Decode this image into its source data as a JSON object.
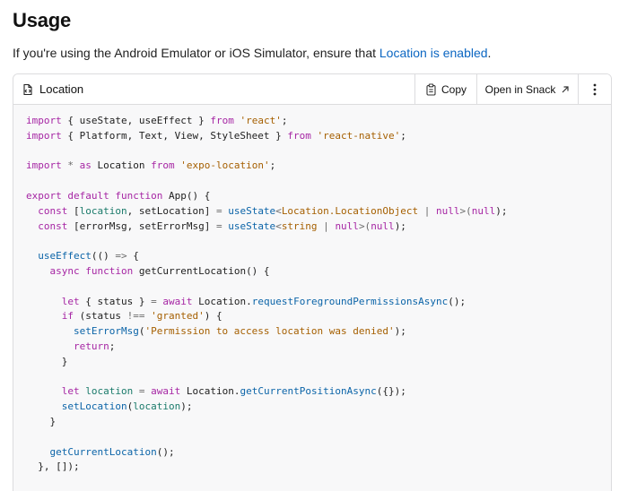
{
  "page": {
    "heading": "Usage",
    "intro_text": "If you're using the Android Emulator or iOS Simulator, ensure that ",
    "intro_link": "Location is enabled",
    "intro_end": "."
  },
  "snippet": {
    "title": "Location",
    "copy_label": "Copy",
    "snack_label": "Open in Snack",
    "icons": {
      "file": "code-file-icon",
      "copy": "clipboard-icon",
      "snack": "external-arrow-icon",
      "more": "vertical-dots-icon"
    },
    "colors": {
      "keyword": "#a626a4",
      "string": "#a55f00",
      "function": "#0b64a8",
      "variable": "#1a7a6a",
      "link": "#0b66c2"
    },
    "code_lines": [
      [
        {
          "t": "import",
          "c": "kw"
        },
        {
          "t": " { useState, useEffect } ",
          "c": "pl"
        },
        {
          "t": "from",
          "c": "kw"
        },
        {
          "t": " ",
          "c": "pl"
        },
        {
          "t": "'react'",
          "c": "str"
        },
        {
          "t": ";",
          "c": "pl"
        }
      ],
      [
        {
          "t": "import",
          "c": "kw"
        },
        {
          "t": " { Platform, Text, View, StyleSheet } ",
          "c": "pl"
        },
        {
          "t": "from",
          "c": "kw"
        },
        {
          "t": " ",
          "c": "pl"
        },
        {
          "t": "'react-native'",
          "c": "str"
        },
        {
          "t": ";",
          "c": "pl"
        }
      ],
      [],
      [
        {
          "t": "import",
          "c": "kw"
        },
        {
          "t": " * ",
          "c": "op"
        },
        {
          "t": "as",
          "c": "kw"
        },
        {
          "t": " Location ",
          "c": "pl"
        },
        {
          "t": "from",
          "c": "kw"
        },
        {
          "t": " ",
          "c": "pl"
        },
        {
          "t": "'expo-location'",
          "c": "str"
        },
        {
          "t": ";",
          "c": "pl"
        }
      ],
      [],
      [
        {
          "t": "export",
          "c": "kw"
        },
        {
          "t": " ",
          "c": "pl"
        },
        {
          "t": "default",
          "c": "kw"
        },
        {
          "t": " ",
          "c": "pl"
        },
        {
          "t": "function",
          "c": "kw"
        },
        {
          "t": " App() {",
          "c": "pl"
        }
      ],
      [
        {
          "t": "  ",
          "c": "pl"
        },
        {
          "t": "const",
          "c": "kw"
        },
        {
          "t": " [",
          "c": "pl"
        },
        {
          "t": "location",
          "c": "vr"
        },
        {
          "t": ", setLocation] ",
          "c": "pl"
        },
        {
          "t": "=",
          "c": "op"
        },
        {
          "t": " useState",
          "c": "fn"
        },
        {
          "t": "<",
          "c": "op"
        },
        {
          "t": "Location.LocationObject",
          "c": "ty"
        },
        {
          "t": " | ",
          "c": "op"
        },
        {
          "t": "null",
          "c": "kw"
        },
        {
          "t": ">(",
          "c": "op"
        },
        {
          "t": "null",
          "c": "kw"
        },
        {
          "t": ");",
          "c": "pl"
        }
      ],
      [
        {
          "t": "  ",
          "c": "pl"
        },
        {
          "t": "const",
          "c": "kw"
        },
        {
          "t": " [errorMsg, setErrorMsg] ",
          "c": "pl"
        },
        {
          "t": "=",
          "c": "op"
        },
        {
          "t": " useState",
          "c": "fn"
        },
        {
          "t": "<",
          "c": "op"
        },
        {
          "t": "string",
          "c": "ty"
        },
        {
          "t": " | ",
          "c": "op"
        },
        {
          "t": "null",
          "c": "kw"
        },
        {
          "t": ">(",
          "c": "op"
        },
        {
          "t": "null",
          "c": "kw"
        },
        {
          "t": ");",
          "c": "pl"
        }
      ],
      [],
      [
        {
          "t": "  ",
          "c": "pl"
        },
        {
          "t": "useEffect",
          "c": "fn"
        },
        {
          "t": "(() ",
          "c": "pl"
        },
        {
          "t": "=>",
          "c": "op"
        },
        {
          "t": " {",
          "c": "pl"
        }
      ],
      [
        {
          "t": "    ",
          "c": "pl"
        },
        {
          "t": "async",
          "c": "kw"
        },
        {
          "t": " ",
          "c": "pl"
        },
        {
          "t": "function",
          "c": "kw"
        },
        {
          "t": " getCurrentLocation() {",
          "c": "pl"
        }
      ],
      [],
      [
        {
          "t": "      ",
          "c": "pl"
        },
        {
          "t": "let",
          "c": "kw"
        },
        {
          "t": " { status } ",
          "c": "pl"
        },
        {
          "t": "=",
          "c": "op"
        },
        {
          "t": " ",
          "c": "pl"
        },
        {
          "t": "await",
          "c": "kw"
        },
        {
          "t": " Location.",
          "c": "pl"
        },
        {
          "t": "requestForegroundPermissionsAsync",
          "c": "fn"
        },
        {
          "t": "();",
          "c": "pl"
        }
      ],
      [
        {
          "t": "      ",
          "c": "pl"
        },
        {
          "t": "if",
          "c": "kw"
        },
        {
          "t": " (status ",
          "c": "pl"
        },
        {
          "t": "!==",
          "c": "op"
        },
        {
          "t": " ",
          "c": "pl"
        },
        {
          "t": "'granted'",
          "c": "str"
        },
        {
          "t": ") {",
          "c": "pl"
        }
      ],
      [
        {
          "t": "        ",
          "c": "pl"
        },
        {
          "t": "setErrorMsg",
          "c": "fn"
        },
        {
          "t": "(",
          "c": "pl"
        },
        {
          "t": "'Permission to access location was denied'",
          "c": "str"
        },
        {
          "t": ");",
          "c": "pl"
        }
      ],
      [
        {
          "t": "        ",
          "c": "pl"
        },
        {
          "t": "return",
          "c": "kw"
        },
        {
          "t": ";",
          "c": "pl"
        }
      ],
      [
        {
          "t": "      }",
          "c": "pl"
        }
      ],
      [],
      [
        {
          "t": "      ",
          "c": "pl"
        },
        {
          "t": "let",
          "c": "kw"
        },
        {
          "t": " ",
          "c": "pl"
        },
        {
          "t": "location",
          "c": "vr"
        },
        {
          "t": " ",
          "c": "pl"
        },
        {
          "t": "=",
          "c": "op"
        },
        {
          "t": " ",
          "c": "pl"
        },
        {
          "t": "await",
          "c": "kw"
        },
        {
          "t": " Location.",
          "c": "pl"
        },
        {
          "t": "getCurrentPositionAsync",
          "c": "fn"
        },
        {
          "t": "({});",
          "c": "pl"
        }
      ],
      [
        {
          "t": "      ",
          "c": "pl"
        },
        {
          "t": "setLocation",
          "c": "fn"
        },
        {
          "t": "(",
          "c": "pl"
        },
        {
          "t": "location",
          "c": "vr"
        },
        {
          "t": ");",
          "c": "pl"
        }
      ],
      [
        {
          "t": "    }",
          "c": "pl"
        }
      ],
      [],
      [
        {
          "t": "    ",
          "c": "pl"
        },
        {
          "t": "getCurrentLocation",
          "c": "fn"
        },
        {
          "t": "();",
          "c": "pl"
        }
      ],
      [
        {
          "t": "  }, []);",
          "c": "pl"
        }
      ]
    ]
  }
}
